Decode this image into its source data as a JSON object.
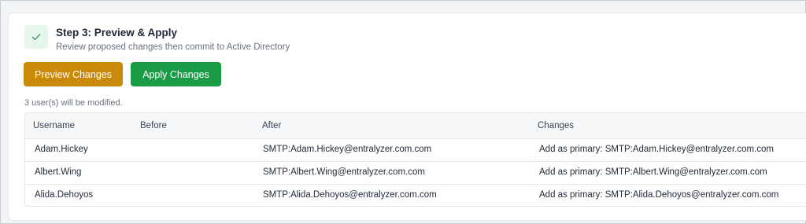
{
  "step": {
    "title": "Step 3: Preview & Apply",
    "subtitle": "Review proposed changes then commit to Active Directory",
    "icon": "check-icon"
  },
  "buttons": {
    "preview_label": "Preview Changes",
    "apply_label": "Apply Changes",
    "preview_color": "#c98a07",
    "apply_color": "#1a9c47"
  },
  "summary": "3 user(s) will be modified.",
  "table": {
    "columns": [
      "Username",
      "Before",
      "After",
      "Changes"
    ],
    "rows": [
      {
        "username": "Adam.Hickey",
        "before": "",
        "after": "SMTP:Adam.Hickey@entralyzer.com.com",
        "changes": "Add as primary: SMTP:Adam.Hickey@entralyzer.com.com"
      },
      {
        "username": "Albert.Wing",
        "before": "",
        "after": "SMTP:Albert.Wing@entralyzer.com.com",
        "changes": "Add as primary: SMTP:Albert.Wing@entralyzer.com.com"
      },
      {
        "username": "Alida.Dehoyos",
        "before": "",
        "after": "SMTP:Alida.Dehoyos@entralyzer.com.com",
        "changes": "Add as primary: SMTP:Alida.Dehoyos@entralyzer.com.com"
      }
    ]
  }
}
